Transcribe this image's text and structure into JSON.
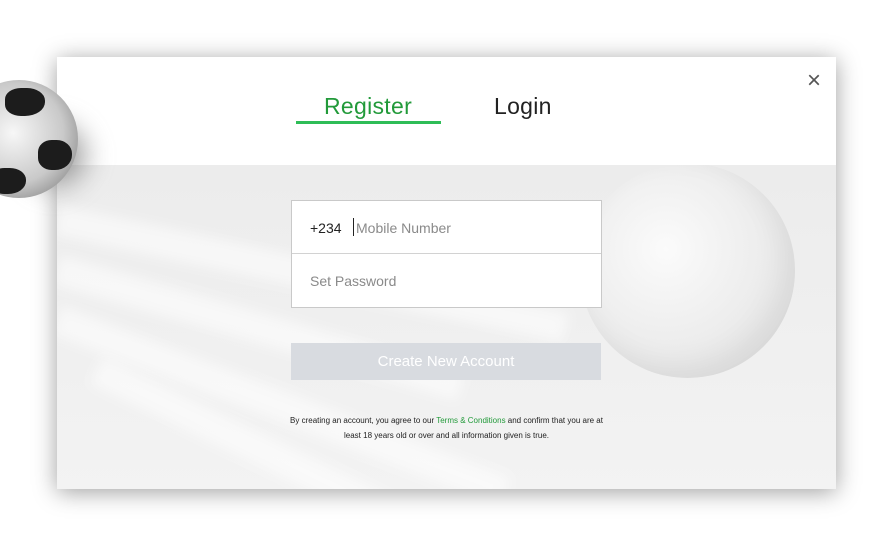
{
  "tabs": {
    "register": "Register",
    "login": "Login"
  },
  "close_icon": "×",
  "form": {
    "phone_prefix": "+234",
    "phone_placeholder": "Mobile Number",
    "password_placeholder": "Set Password"
  },
  "button": {
    "create_account": "Create New Account"
  },
  "terms": {
    "line1_prefix": "By creating an account, you agree to our ",
    "link": "Terms & Conditions",
    "line1_suffix": " and confirm that you are at",
    "line2": "least 18 years old or over and all information given is true."
  },
  "colors": {
    "accent": "#2ebd57",
    "button_disabled": "#d8dbe0"
  }
}
